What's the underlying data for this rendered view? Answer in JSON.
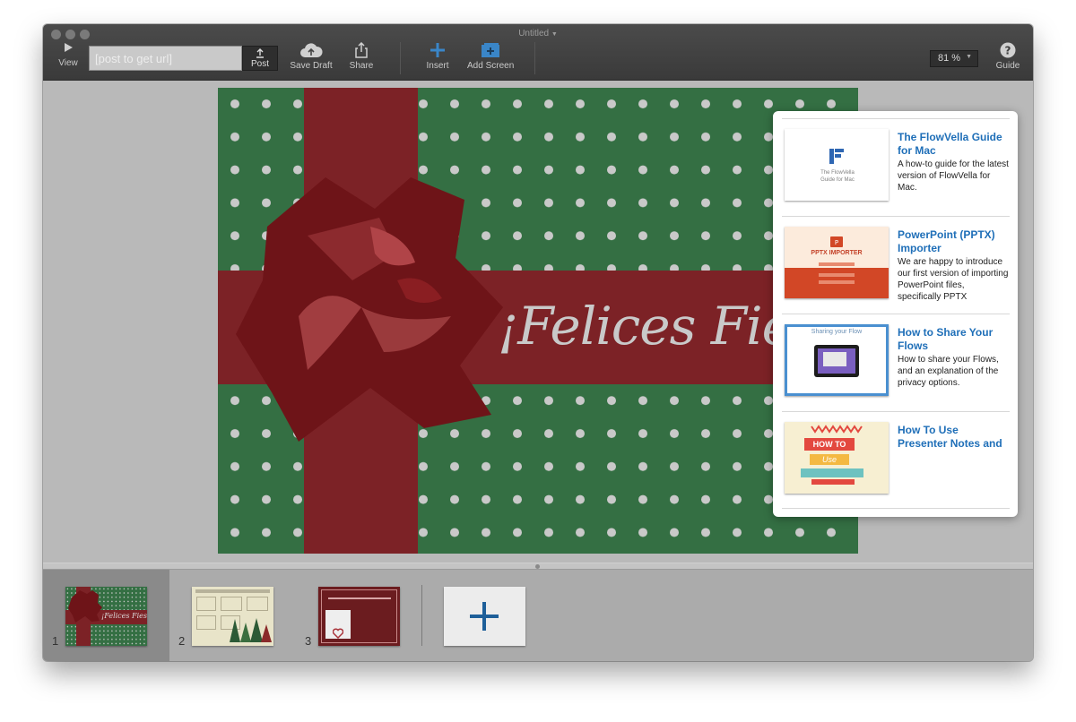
{
  "window": {
    "title": "Untitled"
  },
  "toolbar": {
    "view_label": "View",
    "url_placeholder": "[post to get url]",
    "post_label": "Post",
    "save_draft_label": "Save Draft",
    "share_label": "Share",
    "insert_label": "Insert",
    "add_screen_label": "Add Screen",
    "zoom_value": "81 %",
    "guide_label": "Guide"
  },
  "slide": {
    "text": "¡Felices Fiestas!",
    "colors": {
      "green": "#346f43",
      "ribbon": "#7c2226",
      "dots": "#c9c9c9"
    }
  },
  "guide_panel": {
    "items": [
      {
        "title": "The FlowVella Guide for Mac",
        "description": "A how-to guide for the latest version of FlowVella for Mac.",
        "thumb_text": "The FlowVella Guide for Mac"
      },
      {
        "title": "PowerPoint (PPTX) Importer",
        "description": "We are happy to introduce our first version of importing PowerPoint files, specifically PPTX",
        "thumb_text": "PPTX IMPORTER"
      },
      {
        "title": "How to Share Your Flows",
        "description": "How to share your Flows, and an explanation of the privacy options.",
        "thumb_text": "Sharing your Flow"
      },
      {
        "title": "How To Use Presenter Notes and",
        "description": "",
        "thumb_text_1": "HOW TO",
        "thumb_text_2": "Use"
      }
    ]
  },
  "filmstrip": {
    "screens": [
      {
        "number": "1",
        "text": "¡Felices Fiestas!"
      },
      {
        "number": "2",
        "text": ""
      },
      {
        "number": "3",
        "text": ""
      }
    ]
  },
  "accent_color": "#1f6fb8"
}
